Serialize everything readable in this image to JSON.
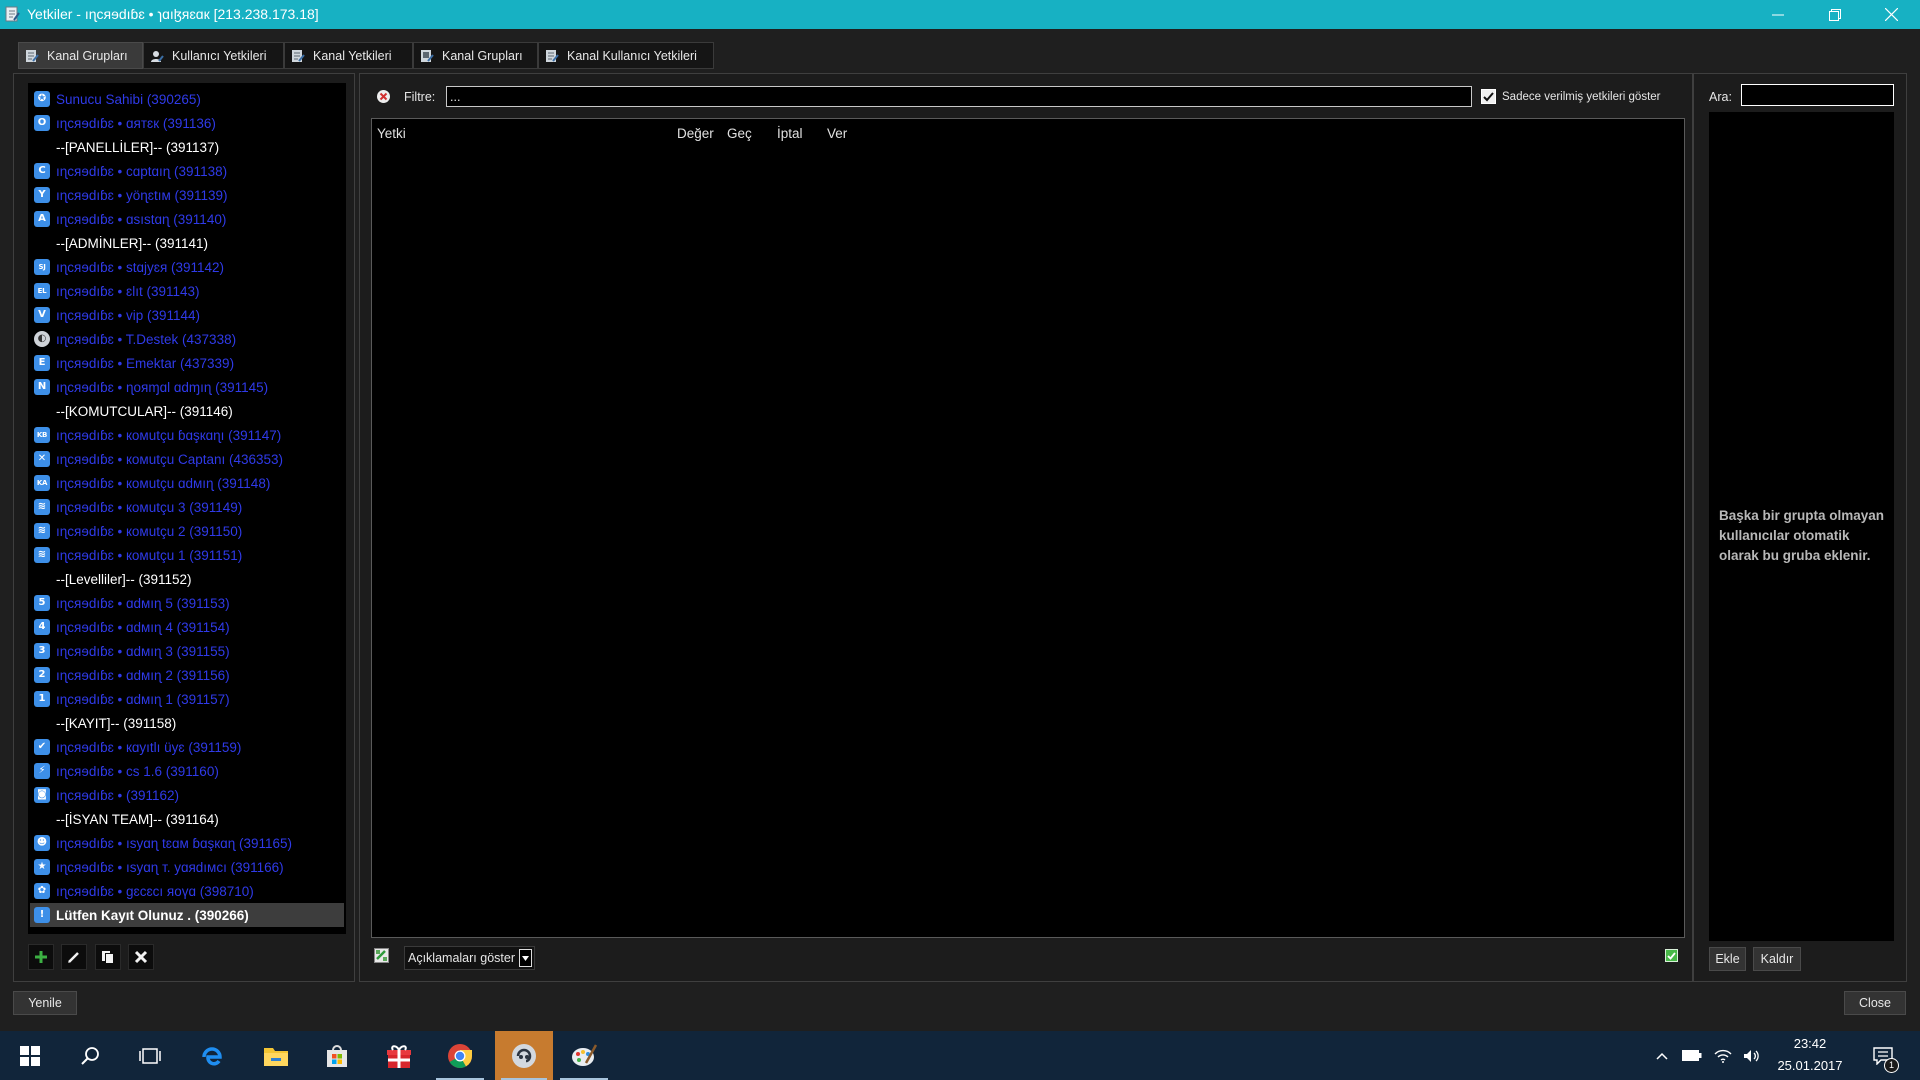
{
  "window": {
    "title": "Yetkiler - ıɳcяɘdıɓɛ • ɿɑıɮяɛɑк [213.238.173.18]"
  },
  "colors": {
    "title_bar": "#17b1c3",
    "group_text": "#2f3ae8",
    "separator_text": "#ffffff",
    "selected_row": "#3d3d3d",
    "badge": "#3d8fe8",
    "taskbar": "#11253a",
    "active_app": "#c77b2f"
  },
  "tabs": [
    {
      "label": "Kanal Grupları",
      "active": true
    },
    {
      "label": "Kullanıcı Yetkileri"
    },
    {
      "label": "Kanal Yetkileri"
    },
    {
      "label": "Kanal Grupları"
    },
    {
      "label": "Kanal Kullanıcı Yetkileri"
    }
  ],
  "left_panel": {
    "groups": [
      {
        "kind": "group",
        "icon": "shield-icon",
        "label": "Sunucu Sahibi (390265)"
      },
      {
        "kind": "group",
        "icon": "letter-badge-icon",
        "badge": "O",
        "label": "ıɳcяɘdıɓɛ • ɑятɛк (391136)"
      },
      {
        "kind": "separator",
        "label": "--[PANELLİLER]-- (391137)"
      },
      {
        "kind": "group",
        "icon": "letter-badge-icon",
        "badge": "C",
        "label": "ıɳcяɘdıɓɛ • cɑptɑıɳ (391138)"
      },
      {
        "kind": "group",
        "icon": "letter-badge-icon",
        "badge": "Y",
        "label": "ıɳcяɘdıɓɛ • yöɳɛtıм (391139)"
      },
      {
        "kind": "group",
        "icon": "letter-badge-icon",
        "badge": "A",
        "label": "ıɳcяɘdıɓɛ • ɑsıstɑɳ (391140)"
      },
      {
        "kind": "separator",
        "label": "--[ADMİNLER]-- (391141)"
      },
      {
        "kind": "group",
        "icon": "letter-badge-icon",
        "badge": "SJ",
        "label": "ıɳcяɘdıɓɛ • stɑjyɛя (391142)"
      },
      {
        "kind": "group",
        "icon": "letter-badge-icon",
        "badge": "EL",
        "label": "ıɳcяɘdıɓɛ • ɛlıt (391143)"
      },
      {
        "kind": "group",
        "icon": "letter-badge-icon",
        "badge": "V",
        "label": "ıɳcяɘdıɓɛ • vip (391144)"
      },
      {
        "kind": "group",
        "icon": "teamspeak-icon",
        "label": "ıɳcяɘdıɓɛ • T.Destek (437338)"
      },
      {
        "kind": "group",
        "icon": "letter-badge-icon",
        "badge": "E",
        "label": "ıɳcяɘdıɓɛ • Emektar (437339)"
      },
      {
        "kind": "group",
        "icon": "letter-badge-icon",
        "badge": "N",
        "label": "ıɳcяɘdıɓɛ • ɳoяɱɑl ɑdɱıɳ (391145)"
      },
      {
        "kind": "separator",
        "label": "--[KOMUTCULAR]-- (391146)"
      },
      {
        "kind": "group",
        "icon": "letter-badge-icon",
        "badge": "KB",
        "label": "ıɳcяɘdıɓɛ • кoмutçu ɓɑşкɑɳı (391147)"
      },
      {
        "kind": "group",
        "icon": "crossed-swords-icon",
        "label": "ıɳcяɘdıɓɛ • кoмutçu Captanı (436353)"
      },
      {
        "kind": "group",
        "icon": "letter-badge-icon",
        "badge": "KA",
        "label": "ıɳcяɘdıɓɛ • кoмutçu ɑdмıɳ (391148)"
      },
      {
        "kind": "group",
        "icon": "rank-chevron-icon",
        "label": "ıɳcяɘdıɓɛ • кoмutçu 3 (391149)"
      },
      {
        "kind": "group",
        "icon": "rank-chevron-icon",
        "label": "ıɳcяɘdıɓɛ • кoмutçu 2 (391150)"
      },
      {
        "kind": "group",
        "icon": "rank-chevron-icon",
        "label": "ıɳcяɘdıɓɛ • кoмutçu 1 (391151)"
      },
      {
        "kind": "separator",
        "label": "--[Levelliler]-- (391152)"
      },
      {
        "kind": "group",
        "icon": "letter-badge-icon",
        "badge": "5",
        "label": "ıɳcяɘdıɓɛ • ɑdмıɳ 5 (391153)"
      },
      {
        "kind": "group",
        "icon": "letter-badge-icon",
        "badge": "4",
        "label": "ıɳcяɘdıɓɛ • ɑdмıɳ 4 (391154)"
      },
      {
        "kind": "group",
        "icon": "letter-badge-icon",
        "badge": "3",
        "label": "ıɳcяɘdıɓɛ • ɑdмıɳ 3 (391155)"
      },
      {
        "kind": "group",
        "icon": "letter-badge-icon",
        "badge": "2",
        "label": "ıɳcяɘdıɓɛ • ɑdмıɳ 2 (391156)"
      },
      {
        "kind": "group",
        "icon": "letter-badge-icon",
        "badge": "1",
        "label": "ıɳcяɘdıɓɛ • ɑdмıɳ 1 (391157)"
      },
      {
        "kind": "separator",
        "label": "--[KAYIT]-- (391158)"
      },
      {
        "kind": "group",
        "icon": "check-icon",
        "label": "ıɳcяɘdıɓɛ • кɑyıtlı üyɛ (391159)"
      },
      {
        "kind": "group",
        "icon": "runner-icon",
        "label": "ıɳcяɘdıɓɛ • cs 1.6 (391160)"
      },
      {
        "kind": "group",
        "icon": "camera-icon",
        "label": "ıɳcяɘdıɓɛ • (391162)"
      },
      {
        "kind": "separator",
        "label": "--[İSYAN TEAM]-- (391164)"
      },
      {
        "kind": "group",
        "icon": "person-icon",
        "label": "ıɳcяɘdıɓɛ • ısyɑɳ tɛɑм ɓɑşкɑɳ (391165)"
      },
      {
        "kind": "group",
        "icon": "star-icon",
        "label": "ıɳcяɘdıɓɛ • ısyɑɳ т. yɑяdıмcı (391166)"
      },
      {
        "kind": "group",
        "icon": "flower-icon",
        "label": "ıɳcяɘdıɓɛ • gɛcɛcı яoүɑ (398710)"
      },
      {
        "kind": "group",
        "icon": "info-icon",
        "label": "Lütfen Kayıt Olunuz . (390266)",
        "selected": true
      }
    ],
    "toolbar": [
      "add-icon",
      "edit-icon",
      "copy-icon",
      "delete-icon"
    ]
  },
  "filter": {
    "label": "Filtre:",
    "value": "...",
    "only_granted_label": "Sadece verilmiş yetkileri göster",
    "only_granted_checked": true
  },
  "permissions_table": {
    "columns": [
      "Yetki",
      "Değer",
      "Geç",
      "İptal",
      "Ver"
    ]
  },
  "descriptions_select": {
    "selected": "Açıklamaları göster"
  },
  "search": {
    "label": "Ara:",
    "value": ""
  },
  "info_text": "Başka bir grupta olmayan kullanıcılar otomatik olarak bu gruba eklenir.",
  "buttons": {
    "add": "Ekle",
    "remove": "Kaldır",
    "refresh": "Yenile",
    "close": "Close"
  },
  "taskbar": {
    "apps": [
      {
        "icon": "windows-start-icon"
      },
      {
        "icon": "search-icon"
      },
      {
        "icon": "task-view-icon"
      },
      {
        "icon": "edge-icon"
      },
      {
        "icon": "file-explorer-icon"
      },
      {
        "icon": "store-icon"
      },
      {
        "icon": "gift-icon"
      },
      {
        "icon": "chrome-icon",
        "running": true
      },
      {
        "icon": "teamspeak-icon",
        "running": true,
        "active": true
      },
      {
        "icon": "paint-icon",
        "running": true
      }
    ],
    "time": "23:42",
    "date": "25.01.2017",
    "notification_count": "1"
  }
}
